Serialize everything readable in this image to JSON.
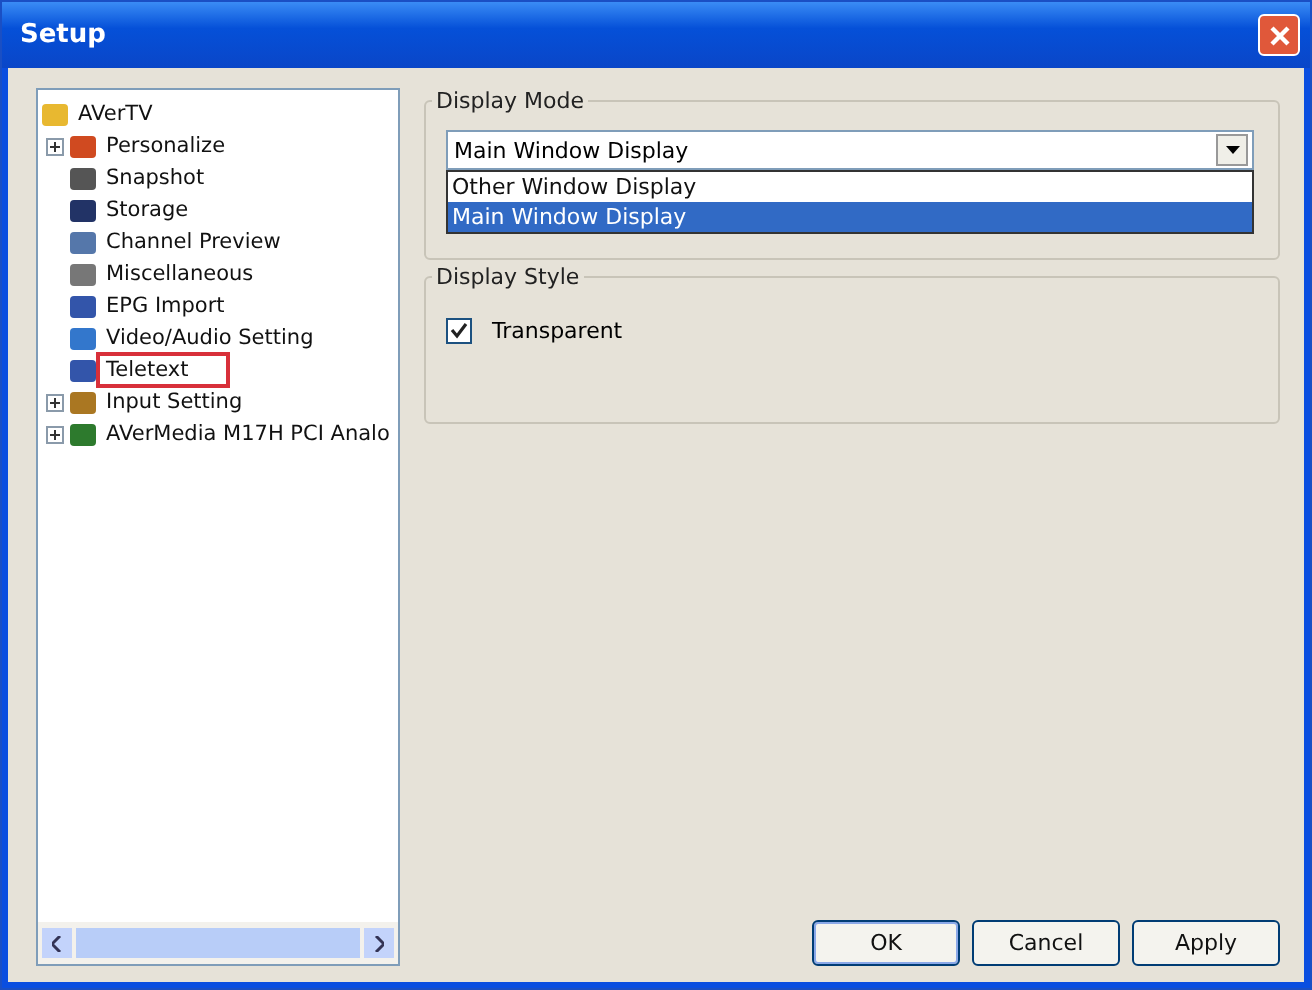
{
  "window": {
    "title": "Setup"
  },
  "tree": {
    "label": "AVerTV",
    "children": [
      {
        "label": "Personalize",
        "expandable": true,
        "highlighted": false
      },
      {
        "label": "Snapshot",
        "expandable": false,
        "highlighted": false
      },
      {
        "label": "Storage",
        "expandable": false,
        "highlighted": false
      },
      {
        "label": "Channel Preview",
        "expandable": false,
        "highlighted": false
      },
      {
        "label": "Miscellaneous",
        "expandable": false,
        "highlighted": false
      },
      {
        "label": "EPG Import",
        "expandable": false,
        "highlighted": false
      },
      {
        "label": "Video/Audio Setting",
        "expandable": false,
        "highlighted": false
      },
      {
        "label": "Teletext",
        "expandable": false,
        "highlighted": true
      },
      {
        "label": "Input Setting",
        "expandable": true,
        "highlighted": false
      },
      {
        "label": "AVerMedia M17H PCI Analo",
        "expandable": true,
        "highlighted": false
      }
    ]
  },
  "display_mode": {
    "title": "Display Mode",
    "value": "Main Window Display",
    "options": [
      {
        "label": "Other Window Display",
        "selected": false
      },
      {
        "label": "Main Window Display",
        "selected": true
      }
    ]
  },
  "display_style": {
    "title": "Display Style",
    "checkbox": {
      "label": "Transparent",
      "checked": true
    }
  },
  "buttons": [
    "OK",
    "Cancel",
    "Apply"
  ]
}
